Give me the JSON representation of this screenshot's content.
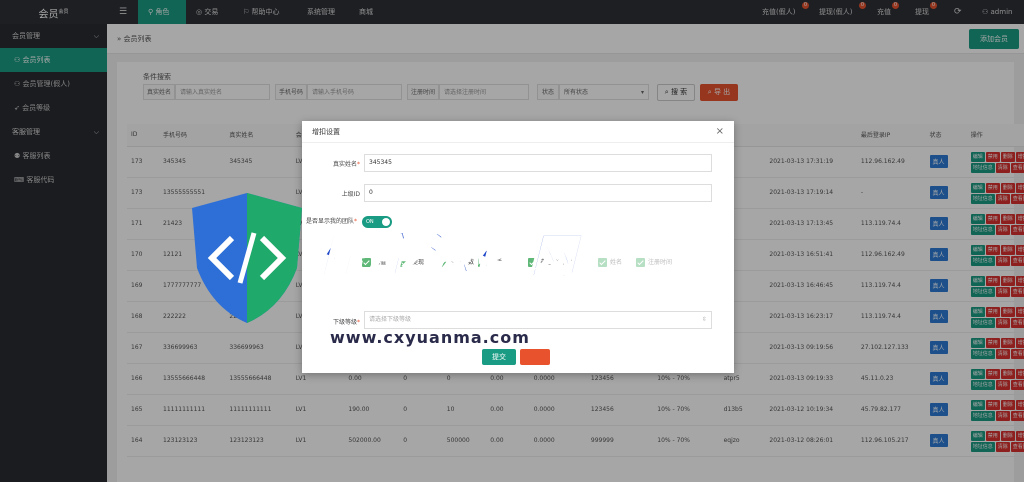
{
  "app": {
    "title": "会员",
    "title_sup": "会员"
  },
  "topnav": {
    "menu_icon": "menu-icon",
    "items": [
      {
        "label": "角色"
      },
      {
        "label": "交易"
      },
      {
        "label": "帮助中心"
      },
      {
        "label": "系统管理"
      },
      {
        "label": "商城"
      }
    ],
    "right": [
      {
        "label": "充值(假人)",
        "badge": "0"
      },
      {
        "label": "提现(假人)",
        "badge": "0"
      },
      {
        "label": "充值",
        "badge": "0"
      },
      {
        "label": "提现",
        "badge": "0"
      }
    ],
    "user": "admin"
  },
  "sidebar": {
    "groups": [
      {
        "label": "会员管理",
        "items": [
          {
            "label": "会员列表"
          },
          {
            "label": "会员管理(假人)"
          },
          {
            "label": "会员等级"
          }
        ]
      },
      {
        "label": "客服管理",
        "items": [
          {
            "label": "客服列表"
          },
          {
            "label": "客服代码"
          }
        ]
      }
    ]
  },
  "main": {
    "breadcrumb": "会员列表",
    "add_button": "添加会员",
    "search": {
      "title": "条件搜索",
      "realname_label": "真实姓名",
      "realname_placeholder": "请输入真实姓名",
      "phone_label": "手机号码",
      "phone_placeholder": "请输入手机号码",
      "regtime_label": "注册时间",
      "regtime_placeholder": "请选择注册时间",
      "status_label": "状态",
      "status_value": "所有状态",
      "search_btn": "搜 索",
      "export_btn": "导 出"
    },
    "table": {
      "headers": [
        "ID",
        "手机号码",
        "真实姓名",
        "会员等级",
        "",
        "",
        "",
        "",
        "",
        "",
        "",
        "",
        "",
        "最后登录IP",
        "状态",
        "操作"
      ],
      "rows": [
        [
          "173",
          "345345",
          "345345",
          "LV1",
          "",
          "",
          "",
          "",
          "",
          "",
          "",
          "",
          "2021-03-13 17:31:19",
          "112.96.162.49",
          "真人"
        ],
        [
          "173",
          "13555555551",
          "",
          "LV1",
          "",
          "",
          "",
          "",
          "",
          "",
          "",
          "",
          "2021-03-13 17:19:14",
          "-",
          "真人"
        ],
        [
          "171",
          "21423",
          "",
          "LV1",
          "",
          "",
          "",
          "",
          "",
          "",
          "",
          "",
          "2021-03-13 17:13:45",
          "113.119.74.4",
          "真人"
        ],
        [
          "170",
          "12121",
          "",
          "LV1",
          "",
          "",
          "",
          "",
          "",
          "",
          "",
          "",
          "2021-03-13 16:51:41",
          "112.96.162.49",
          "真人"
        ],
        [
          "169",
          "1777777777",
          "",
          "LV1",
          "",
          "",
          "",
          "",
          "",
          "",
          "",
          "",
          "2021-03-13 16:46:45",
          "113.119.74.4",
          "真人"
        ],
        [
          "168",
          "222222",
          "222222",
          "LV1",
          "",
          "",
          "",
          "",
          "",
          "",
          "",
          "",
          "2021-03-13 16:23:17",
          "113.119.74.4",
          "真人"
        ],
        [
          "167",
          "336699963",
          "336699963",
          "LV1",
          "",
          "",
          "",
          "",
          "",
          "",
          "",
          "",
          "2021-03-13 09:19:56",
          "27.102.127.133",
          "真人"
        ],
        [
          "166",
          "13555666448",
          "13555666448",
          "LV1",
          "0.00",
          "0",
          "0",
          "0.00",
          "0.0000",
          "123456",
          "10% - 70%",
          "atpr5",
          "2021-03-13 09:19:33",
          "45.11.0.23",
          "真人"
        ],
        [
          "165",
          "11111111111",
          "11111111111",
          "LV1",
          "190.00",
          "0",
          "10",
          "0.00",
          "0.0000",
          "123456",
          "10% - 70%",
          "d13b5",
          "2021-03-12 10:19:34",
          "45.79.82.177",
          "真人"
        ],
        [
          "164",
          "123123123",
          "123123123",
          "LV1",
          "502000.00",
          "0",
          "500000",
          "0.00",
          "0.0000",
          "999999",
          "10% - 70%",
          "eqjzo",
          "2021-03-12 08:26:01",
          "112.96.105.217",
          "真人"
        ]
      ],
      "ops": [
        [
          "编辑",
          "g"
        ],
        [
          "禁用",
          "r"
        ],
        [
          "删除",
          "r"
        ],
        [
          "增扣设置",
          "r"
        ],
        [
          "银行卡信息",
          "g"
        ],
        [
          "地址信息",
          "g"
        ],
        [
          "清除",
          "r"
        ],
        [
          "查看团队",
          "r"
        ],
        [
          "推荐",
          "b"
        ],
        [
          "设为假人",
          "g"
        ]
      ]
    }
  },
  "modal": {
    "title": "增扣设置",
    "realname_label": "真实姓名",
    "realname_value": "345345",
    "parent_label": "上级ID",
    "parent_value": "0",
    "team_label": "是否显示我的团队",
    "switch_label": "ON",
    "checkboxes": [
      {
        "label": "充值",
        "disabled": false
      },
      {
        "label": "提现",
        "disabled": false
      },
      {
        "label": "推荐人数",
        "disabled": false
      },
      {
        "label": "电话",
        "disabled": false
      },
      {
        "label": "电话隐藏部分",
        "disabled": false
      },
      {
        "label": "姓名",
        "disabled": true
      },
      {
        "label": "注册时间",
        "disabled": true
      }
    ],
    "level_label": "下级等级",
    "level_placeholder": "请选择下级等级",
    "submit": "提交"
  },
  "watermark": {
    "text": "程序源码网",
    "url": "www.cxyuanma.com"
  }
}
